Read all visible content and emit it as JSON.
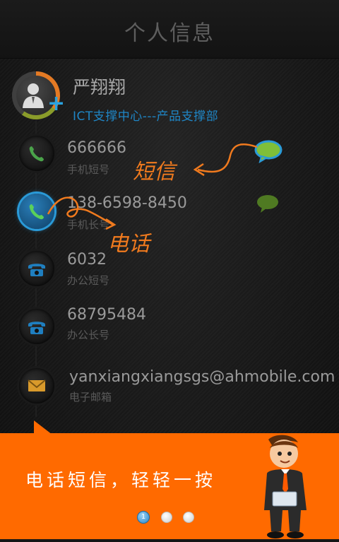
{
  "header": {
    "title": "个人信息"
  },
  "profile": {
    "name": "严翔翔",
    "department": "ICT支撑中心---产品支撑部"
  },
  "contacts": [
    {
      "value": "666666",
      "label": "手机短号",
      "icon": "phone-icon"
    },
    {
      "value": "138-6598-8450",
      "label": "手机长号",
      "icon": "phone-icon"
    },
    {
      "value": "6032",
      "label": "办公短号",
      "icon": "telephone-icon"
    },
    {
      "value": "68795484",
      "label": "办公长号",
      "icon": "telephone-icon"
    },
    {
      "value": "yanxiangxiangsgs@ahmobile.com",
      "label": "电子邮箱",
      "icon": "mail-icon"
    }
  ],
  "annotations": {
    "sms": "短信",
    "call": "电话"
  },
  "banner": {
    "text": "电话短信，轻轻一按"
  },
  "pager": {
    "current": "1",
    "total_dots": 3
  },
  "colors": {
    "accent": "#2a9ad8",
    "banner": "#ff6a00",
    "annotation": "#f07a1e",
    "department": "#1f86c6"
  }
}
